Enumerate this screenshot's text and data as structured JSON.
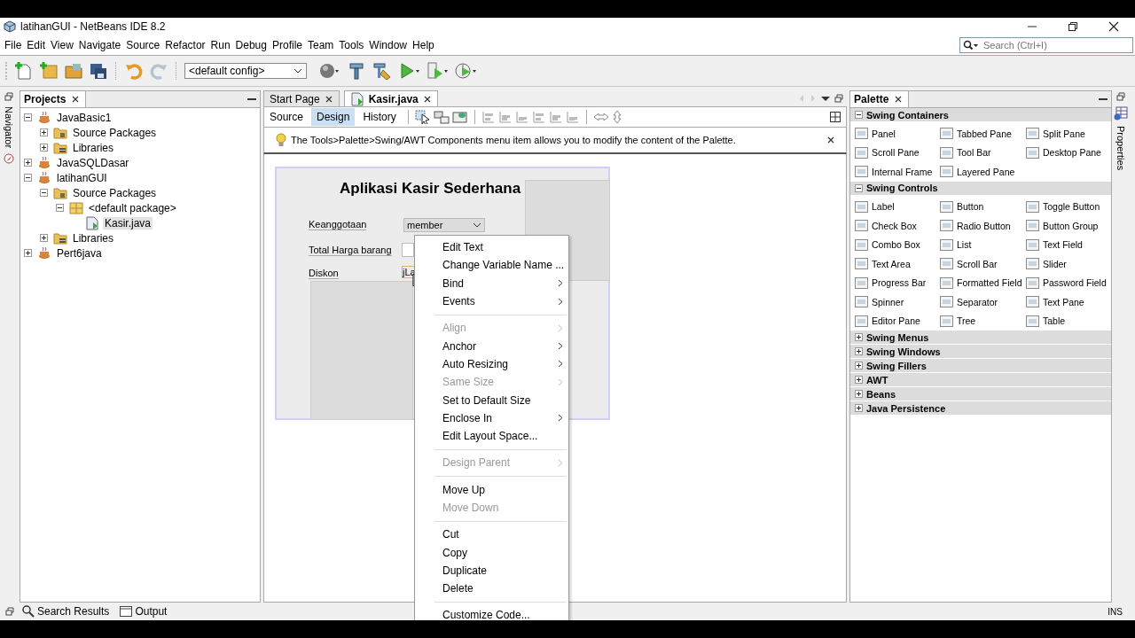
{
  "window": {
    "title": "latihanGUI - NetBeans IDE 8.2"
  },
  "menu": [
    "File",
    "Edit",
    "View",
    "Navigate",
    "Source",
    "Refactor",
    "Run",
    "Debug",
    "Profile",
    "Team",
    "Tools",
    "Window",
    "Help"
  ],
  "search": {
    "placeholder": "Search (Ctrl+I)"
  },
  "toolbar": {
    "config": "<default config>"
  },
  "navigator": {
    "label": "Navigator"
  },
  "projects": {
    "title": "Projects",
    "tree": [
      {
        "label": "JavaBasic1",
        "kind": "project",
        "expanded": true,
        "selected": false,
        "children": [
          {
            "label": "Source Packages",
            "kind": "source",
            "expanded": false,
            "selected": false
          },
          {
            "label": "Libraries",
            "kind": "library",
            "expanded": false,
            "selected": false
          }
        ]
      },
      {
        "label": "JavaSQLDasar",
        "kind": "project",
        "expanded": false,
        "selected": false
      },
      {
        "label": "latihanGUI",
        "kind": "project",
        "expanded": true,
        "selected": false,
        "children": [
          {
            "label": "Source Packages",
            "kind": "source",
            "expanded": true,
            "selected": false,
            "children": [
              {
                "label": "<default package>",
                "kind": "package",
                "expanded": true,
                "selected": false,
                "children": [
                  {
                    "label": "Kasir.java",
                    "kind": "file",
                    "selected": true
                  }
                ]
              }
            ]
          },
          {
            "label": "Libraries",
            "kind": "library",
            "expanded": false,
            "selected": false
          }
        ]
      },
      {
        "label": "Pert6java",
        "kind": "project",
        "expanded": false,
        "selected": false
      }
    ]
  },
  "editor": {
    "tabs": [
      {
        "label": "Start Page",
        "selected": false
      },
      {
        "label": "Kasir.java",
        "selected": true
      }
    ],
    "views": [
      {
        "label": "Source",
        "selected": false
      },
      {
        "label": "Design",
        "selected": true
      },
      {
        "label": "History",
        "selected": false
      }
    ],
    "hint": "The Tools>Palette>Swing/AWT Components menu item allows you to modify the content of the Palette.",
    "form": {
      "title": "Aplikasi Kasir Sederhana",
      "labels": [
        "Keanggotaan",
        "Total Harga barang",
        "Diskon"
      ],
      "combo": "member",
      "selected_label": "jLa"
    }
  },
  "context_menu": [
    {
      "kind": "item",
      "label": "Edit Text",
      "disabled": false,
      "submenu": false
    },
    {
      "kind": "item",
      "label": "Change Variable Name ...",
      "disabled": false,
      "submenu": false
    },
    {
      "kind": "item",
      "label": "Bind",
      "disabled": false,
      "submenu": true
    },
    {
      "kind": "item",
      "label": "Events",
      "disabled": false,
      "submenu": true
    },
    {
      "kind": "separator"
    },
    {
      "kind": "item",
      "label": "Align",
      "disabled": true,
      "submenu": true
    },
    {
      "kind": "item",
      "label": "Anchor",
      "disabled": false,
      "submenu": true
    },
    {
      "kind": "item",
      "label": "Auto Resizing",
      "disabled": false,
      "submenu": true
    },
    {
      "kind": "item",
      "label": "Same Size",
      "disabled": true,
      "submenu": true
    },
    {
      "kind": "item",
      "label": "Set to Default Size",
      "disabled": false,
      "submenu": false
    },
    {
      "kind": "item",
      "label": "Enclose In",
      "disabled": false,
      "submenu": true
    },
    {
      "kind": "item",
      "label": "Edit Layout Space...",
      "disabled": false,
      "submenu": false
    },
    {
      "kind": "separator"
    },
    {
      "kind": "item",
      "label": "Design Parent",
      "disabled": true,
      "submenu": true
    },
    {
      "kind": "separator"
    },
    {
      "kind": "item",
      "label": "Move Up",
      "disabled": false,
      "submenu": false
    },
    {
      "kind": "item",
      "label": "Move Down",
      "disabled": true,
      "submenu": false
    },
    {
      "kind": "separator"
    },
    {
      "kind": "item",
      "label": "Cut",
      "disabled": false,
      "submenu": false
    },
    {
      "kind": "item",
      "label": "Copy",
      "disabled": false,
      "submenu": false
    },
    {
      "kind": "item",
      "label": "Duplicate",
      "disabled": false,
      "submenu": false
    },
    {
      "kind": "item",
      "label": "Delete",
      "disabled": false,
      "submenu": false
    },
    {
      "kind": "separator"
    },
    {
      "kind": "item",
      "label": "Customize Code...",
      "disabled": false,
      "submenu": false
    }
  ],
  "palette": {
    "title": "Palette",
    "groups": [
      {
        "label": "Swing Containers",
        "expanded": true,
        "items": [
          "Panel",
          "Tabbed Pane",
          "Split Pane",
          "Scroll Pane",
          "Tool Bar",
          "Desktop Pane",
          "Internal Frame",
          "Layered Pane"
        ]
      },
      {
        "label": "Swing Controls",
        "expanded": true,
        "items": [
          "Label",
          "Button",
          "Toggle Button",
          "Check Box",
          "Radio Button",
          "Button Group",
          "Combo Box",
          "List",
          "Text Field",
          "Text Area",
          "Scroll Bar",
          "Slider",
          "Progress Bar",
          "Formatted Field",
          "Password Field",
          "Spinner",
          "Separator",
          "Text Pane",
          "Editor Pane",
          "Tree",
          "Table"
        ]
      },
      {
        "label": "Swing Menus",
        "expanded": false
      },
      {
        "label": "Swing Windows",
        "expanded": false
      },
      {
        "label": "Swing Fillers",
        "expanded": false
      },
      {
        "label": "AWT",
        "expanded": false
      },
      {
        "label": "Beans",
        "expanded": false
      },
      {
        "label": "Java Persistence",
        "expanded": false
      }
    ]
  },
  "properties": {
    "label": "Properties"
  },
  "status_bar": {
    "tabs": [
      "Search Results",
      "Output"
    ],
    "mode": "INS"
  }
}
